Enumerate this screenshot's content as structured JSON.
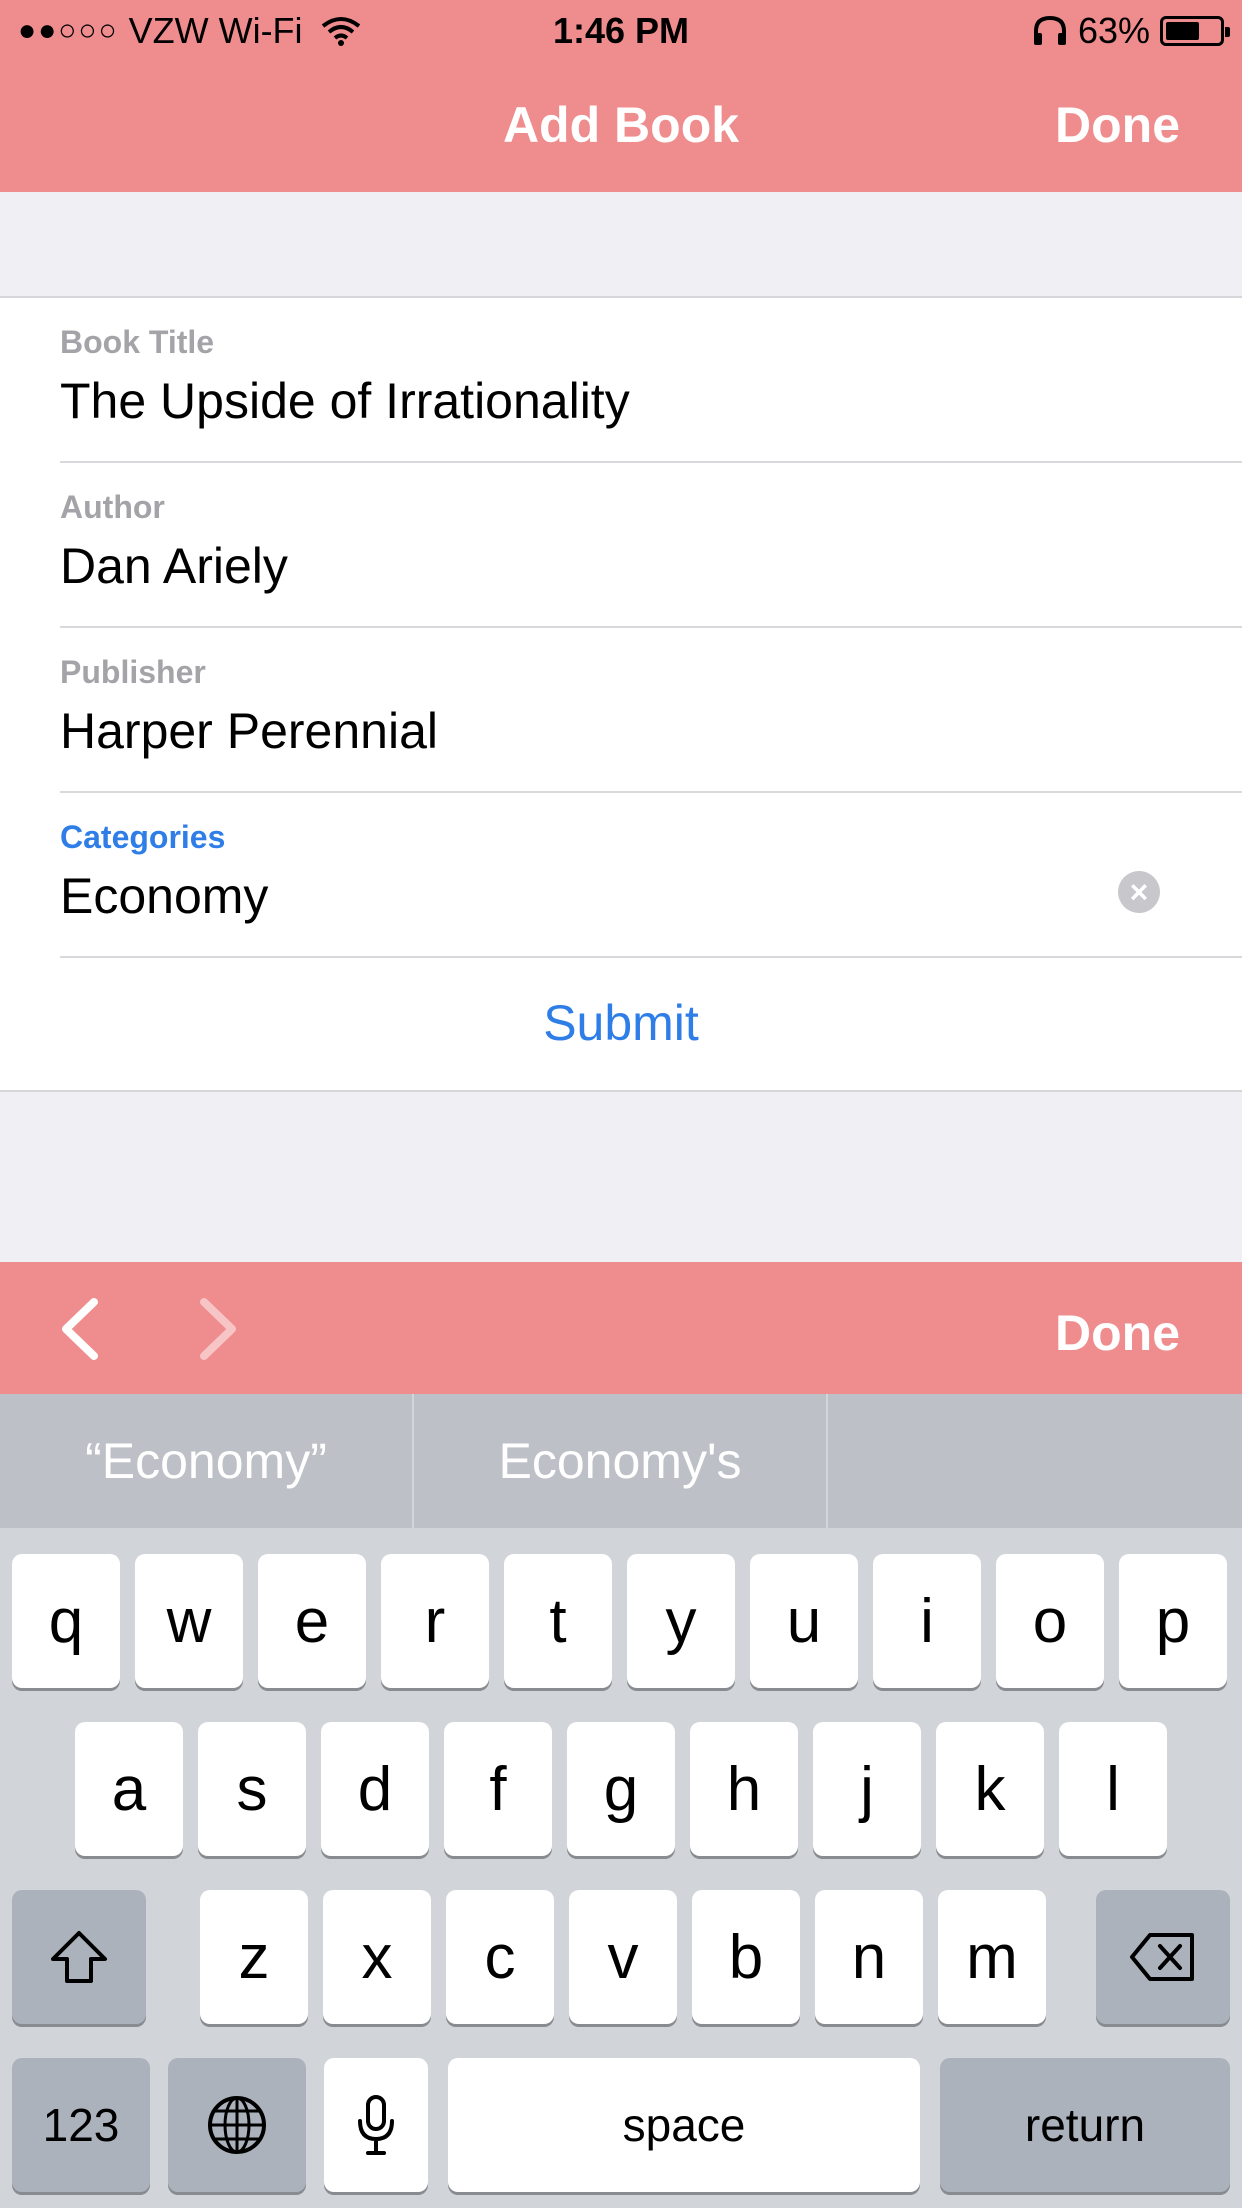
{
  "status_bar": {
    "carrier": "VZW Wi-Fi",
    "signal": "●●○○○",
    "time": "1:46 PM",
    "battery_percent": "63%",
    "battery_level": 0.63
  },
  "nav": {
    "title": "Add Book",
    "done_label": "Done"
  },
  "form": {
    "fields": [
      {
        "label": "Book Title",
        "value": "The Upside of Irrationality"
      },
      {
        "label": "Author",
        "value": "Dan Ariely"
      },
      {
        "label": "Publisher",
        "value": "Harper Perennial"
      },
      {
        "label": "Categories",
        "value": "Economy"
      }
    ],
    "submit_label": "Submit"
  },
  "accessory": {
    "done_label": "Done"
  },
  "keyboard": {
    "predictions": [
      "“Economy”",
      "Economy's",
      ""
    ],
    "row1": [
      "q",
      "w",
      "e",
      "r",
      "t",
      "y",
      "u",
      "i",
      "o",
      "p"
    ],
    "row2": [
      "a",
      "s",
      "d",
      "f",
      "g",
      "h",
      "j",
      "k",
      "l"
    ],
    "row3": [
      "z",
      "x",
      "c",
      "v",
      "b",
      "n",
      "m"
    ],
    "numbers_label": "123",
    "space_label": "space",
    "return_label": "return"
  },
  "colors": {
    "accent": "#ef8c8e",
    "link": "#2f7ee8"
  }
}
